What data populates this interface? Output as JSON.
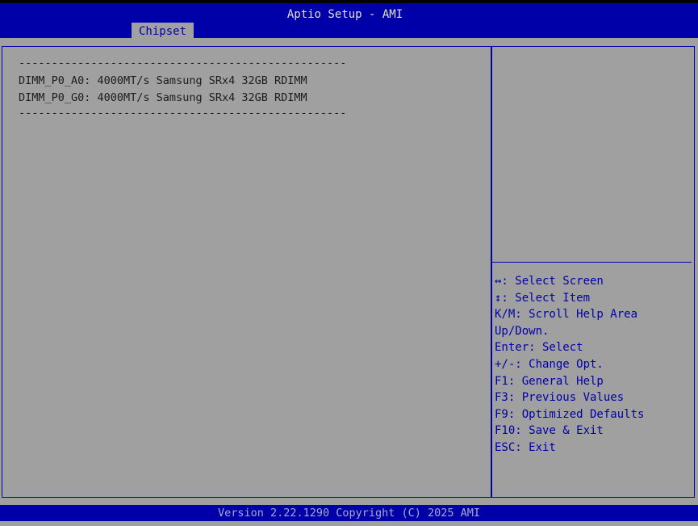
{
  "header": {
    "title": "Aptio Setup - AMI",
    "active_tab": "Chipset"
  },
  "main": {
    "separator_top": "--------------------------------------------------",
    "dimms": [
      "DIMM_P0_A0: 4000MT/s Samsung SRx4 32GB RDIMM",
      "DIMM_P0_G0: 4000MT/s Samsung SRx4 32GB RDIMM"
    ],
    "separator_bottom": "--------------------------------------------------"
  },
  "help": {
    "lines": [
      "↔: Select Screen",
      "↕: Select Item",
      "K/M: Scroll Help Area",
      "Up/Down.",
      "Enter: Select",
      "+/-: Change Opt.",
      "F1: General Help",
      "F3: Previous Values",
      "F9: Optimized Defaults",
      "F10: Save & Exit",
      "ESC: Exit"
    ]
  },
  "footer": {
    "version": "Version 2.22.1290 Copyright (C) 2025 AMI"
  },
  "colors": {
    "frame_blue": "#0000a8",
    "background_gray": "#a0a0a0",
    "text_dark": "#1c1c1c"
  }
}
